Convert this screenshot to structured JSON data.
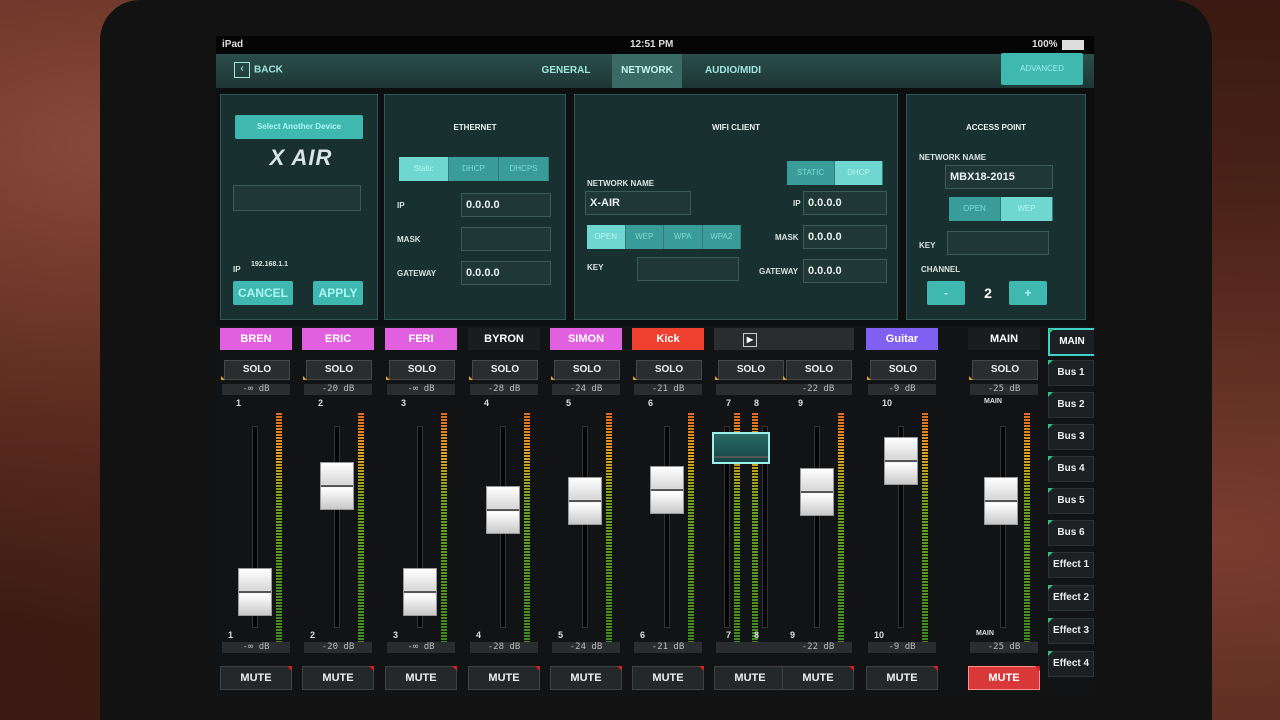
{
  "status": {
    "device": "iPad",
    "time": "12:51 PM",
    "battery": "100%"
  },
  "nav": {
    "back": "BACK",
    "tabs": [
      {
        "label": "GENERAL"
      },
      {
        "label": "NETWORK"
      },
      {
        "label": "AUDIO/MIDI"
      }
    ],
    "advanced": "ADVANCED"
  },
  "device_panel": {
    "select_button": "Select Another Device",
    "logo": "X AIR",
    "ip_label": "IP",
    "ip_value": "192.168.1.1",
    "cancel": "CANCEL",
    "apply": "APPLY"
  },
  "ethernet": {
    "title": "ETHERNET",
    "modes": [
      "Static",
      "DHCP",
      "DHCPS"
    ],
    "ip_label": "IP",
    "ip_value": "0.0.0.0",
    "mask_label": "MASK",
    "mask_value": "",
    "gateway_label": "GATEWAY",
    "gateway_value": "0.0.0.0"
  },
  "wifi": {
    "title": "WIFI CLIENT",
    "network_name_label": "NETWORK NAME",
    "network_name_value": "X-AIR",
    "security": [
      "OPEN",
      "WEP",
      "WPA",
      "WPA2"
    ],
    "key_label": "KEY",
    "modes": [
      "STATIC",
      "DHCP"
    ],
    "ip_label": "IP",
    "ip_value": "0.0.0.0",
    "mask_label": "MASK",
    "mask_value": "0.0.0.0",
    "gateway_label": "GATEWAY",
    "gateway_value": "0.0.0.0"
  },
  "access_point": {
    "title": "ACCESS POINT",
    "network_name_label": "NETWORK NAME",
    "network_name_value": "MBX18-2015",
    "security": [
      "OPEN",
      "WEP"
    ],
    "key_label": "KEY",
    "channel_label": "CHANNEL",
    "channel_value": "2",
    "minus": "-",
    "plus": "+"
  },
  "channels": [
    {
      "name": "BREN",
      "color": "#e060e0",
      "solo": "SOLO",
      "level": "-∞ dB",
      "num": "1",
      "fader": 0.0,
      "mute": "MUTE"
    },
    {
      "name": "ERIC",
      "color": "#e060e0",
      "solo": "SOLO",
      "level": "-20 dB",
      "num": "2",
      "fader": 0.58,
      "mute": "MUTE"
    },
    {
      "name": "FERI",
      "color": "#e060e0",
      "solo": "SOLO",
      "level": "-∞ dB",
      "num": "3",
      "fader": 0.0,
      "mute": "MUTE"
    },
    {
      "name": "BYRON",
      "color": "#1a1c1e",
      "solo": "SOLO",
      "level": "-28 dB",
      "num": "4",
      "fader": 0.45,
      "mute": "MUTE"
    },
    {
      "name": "SIMON",
      "color": "#e060e0",
      "solo": "SOLO",
      "level": "-24 dB",
      "num": "5",
      "fader": 0.5,
      "mute": "MUTE"
    },
    {
      "name": "Kick",
      "color": "#f04030",
      "solo": "SOLO",
      "level": "-21 dB",
      "num": "6",
      "fader": 0.56,
      "mute": "MUTE"
    },
    {
      "name": "",
      "color": "#2a2d2f",
      "solo": "SOLO",
      "level": "",
      "num": "7",
      "num2": "8",
      "fader": 0.75,
      "mute": "MUTE"
    },
    {
      "name": "",
      "color": "#2a2d2f",
      "solo": "SOLO",
      "level": "-22 dB",
      "num": "9",
      "fader": 0.55,
      "mute": "MUTE"
    },
    {
      "name": "Guitar",
      "color": "#8060f0",
      "solo": "SOLO",
      "level": "-9 dB",
      "num": "10",
      "fader": 0.72,
      "mute": "MUTE"
    }
  ],
  "main": {
    "name": "MAIN",
    "solo": "SOLO",
    "level": "-25 dB",
    "num": "MAIN",
    "fader": 0.5,
    "mute": "MUTE"
  },
  "buses": [
    "MAIN",
    "Bus 1",
    "Bus 2",
    "Bus 3",
    "Bus 4",
    "Bus 5",
    "Bus 6",
    "Effect 1",
    "Effect 2",
    "Effect 3",
    "Effect 4"
  ]
}
